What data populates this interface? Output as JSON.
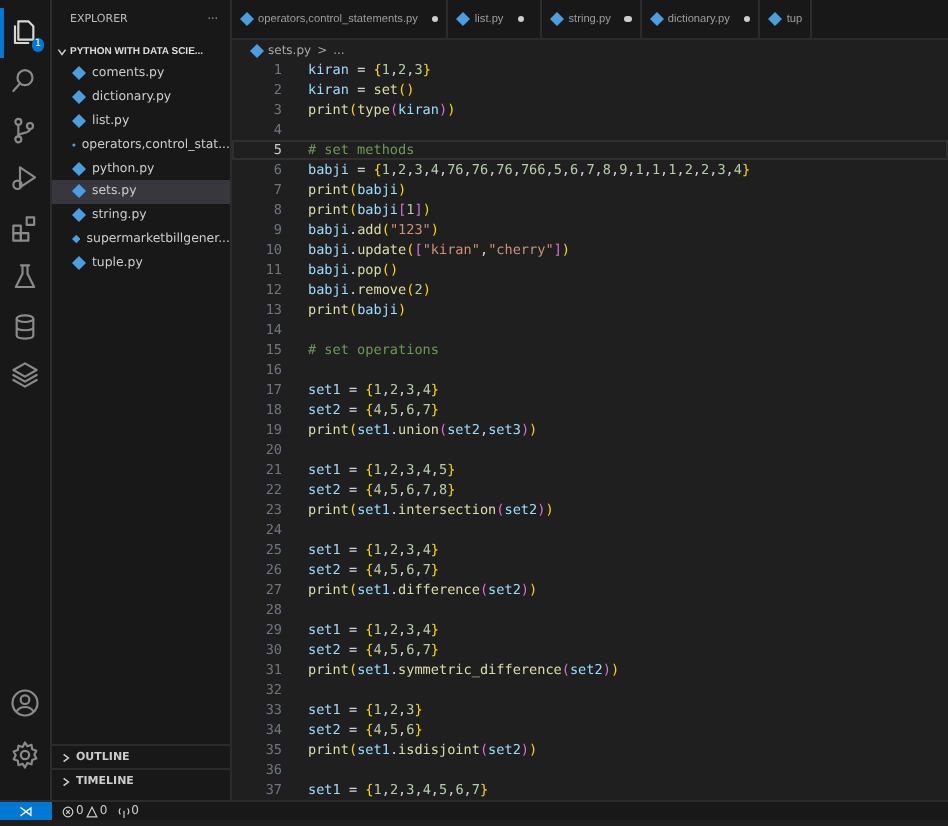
{
  "activity_bar": {
    "badge": "1",
    "items": [
      {
        "kind": "files",
        "selected": true
      },
      {
        "kind": "search",
        "selected": false
      },
      {
        "kind": "source-control",
        "selected": false
      },
      {
        "kind": "run",
        "selected": false
      },
      {
        "kind": "extensions",
        "selected": false
      },
      {
        "kind": "testing",
        "selected": false
      },
      {
        "kind": "database",
        "selected": false
      },
      {
        "kind": "layers",
        "selected": false
      }
    ],
    "bottom": [
      {
        "kind": "account"
      },
      {
        "kind": "settings"
      }
    ]
  },
  "sidebar": {
    "title": "EXPLORER",
    "more": "···",
    "folder": "PYTHON WITH DATA SCIE...",
    "files": [
      {
        "name": "coments.py",
        "selected": false
      },
      {
        "name": "dictionary.py",
        "selected": false
      },
      {
        "name": "list.py",
        "selected": false
      },
      {
        "name": "operators,control_stat...",
        "selected": false
      },
      {
        "name": "python.py",
        "selected": false
      },
      {
        "name": "sets.py",
        "selected": true
      },
      {
        "name": "string.py",
        "selected": false
      },
      {
        "name": "supermarketbillgener...",
        "selected": false
      },
      {
        "name": "tuple.py",
        "selected": false
      }
    ],
    "sections": [
      "OUTLINE",
      "TIMELINE"
    ]
  },
  "tabs": [
    {
      "label": "operators,control_statements.py",
      "modified": true,
      "selected": false
    },
    {
      "label": "list.py",
      "modified": true,
      "selected": false
    },
    {
      "label": "string.py",
      "modified": true,
      "selected": false
    },
    {
      "label": "dictionary.py",
      "modified": true,
      "selected": false
    },
    {
      "label": "tup",
      "modified": false,
      "selected": false
    }
  ],
  "breadcrumb": [
    "sets.py",
    ">",
    "..."
  ],
  "lines": [
    {
      "number": "1",
      "text": "kiran = {1,2,3}",
      "active": false
    },
    {
      "number": "2",
      "text": "kiran = set()",
      "active": false
    },
    {
      "number": "3",
      "text": "print(type(kiran))",
      "active": false
    },
    {
      "number": "4",
      "active": false
    },
    {
      "number": "5",
      "text": "# set methods",
      "active": true
    },
    {
      "number": "6",
      "text": "babji = {1,2,3,4,76,76,76,766,5,6,7,8,9,1,1,1,2,2,3,4}",
      "active": false
    },
    {
      "number": "7",
      "text": "print(babji)",
      "active": false
    },
    {
      "number": "8",
      "text": "print(babji[1])",
      "active": false
    },
    {
      "number": "9",
      "text": "babji.add(\"123\")",
      "active": false
    },
    {
      "number": "10",
      "text": "babji.update([\"kiran\",\"cherry\"])",
      "active": false
    },
    {
      "number": "11",
      "text": "babji.pop()",
      "active": false
    },
    {
      "number": "12",
      "text": "babji.remove(2)",
      "active": false
    },
    {
      "number": "13",
      "text": "print(babji)",
      "active": false
    },
    {
      "number": "14",
      "active": false
    },
    {
      "number": "15",
      "text": "# set operations",
      "active": false
    },
    {
      "number": "16",
      "active": false
    },
    {
      "number": "17",
      "text": "set1 = {1,2,3,4}",
      "active": false
    },
    {
      "number": "18",
      "text": "set2 = {4,5,6,7}",
      "active": false
    },
    {
      "number": "19",
      "text": "print(set1.union(set2,set3))",
      "active": false
    },
    {
      "number": "20",
      "active": false
    },
    {
      "number": "21",
      "text": "set1 = {1,2,3,4,5}",
      "active": false
    },
    {
      "number": "22",
      "text": "set2 = {4,5,6,7,8}",
      "active": false
    },
    {
      "number": "23",
      "text": "print(set1.intersection(set2))",
      "active": false
    },
    {
      "number": "24",
      "active": false
    },
    {
      "number": "25",
      "text": "set1 = {1,2,3,4}",
      "active": false
    },
    {
      "number": "26",
      "text": "set2 = {4,5,6,7}",
      "active": false
    },
    {
      "number": "27",
      "text": "print(set1.difference(set2))",
      "active": false
    },
    {
      "number": "28",
      "active": false
    },
    {
      "number": "29",
      "text": "set1 = {1,2,3,4}",
      "active": false
    },
    {
      "number": "30",
      "text": "set2 = {4,5,6,7}",
      "active": false
    },
    {
      "number": "31",
      "text": "print(set1.symmetric_difference(set2))",
      "active": false
    },
    {
      "number": "32",
      "active": false
    },
    {
      "number": "33",
      "text": "set1 = {1,2,3}",
      "active": false
    },
    {
      "number": "34",
      "text": "set2 = {4,5,6}",
      "active": false
    },
    {
      "number": "35",
      "text": "print(set1.isdisjoint(set2))",
      "active": false
    },
    {
      "number": "36",
      "active": false
    },
    {
      "number": "37",
      "text": "set1 = {1,2,3,4,5,6,7}",
      "active": false
    }
  ],
  "status_bar": {
    "remote": "⋊",
    "errors": "0",
    "warnings": "0",
    "ports": "0"
  }
}
